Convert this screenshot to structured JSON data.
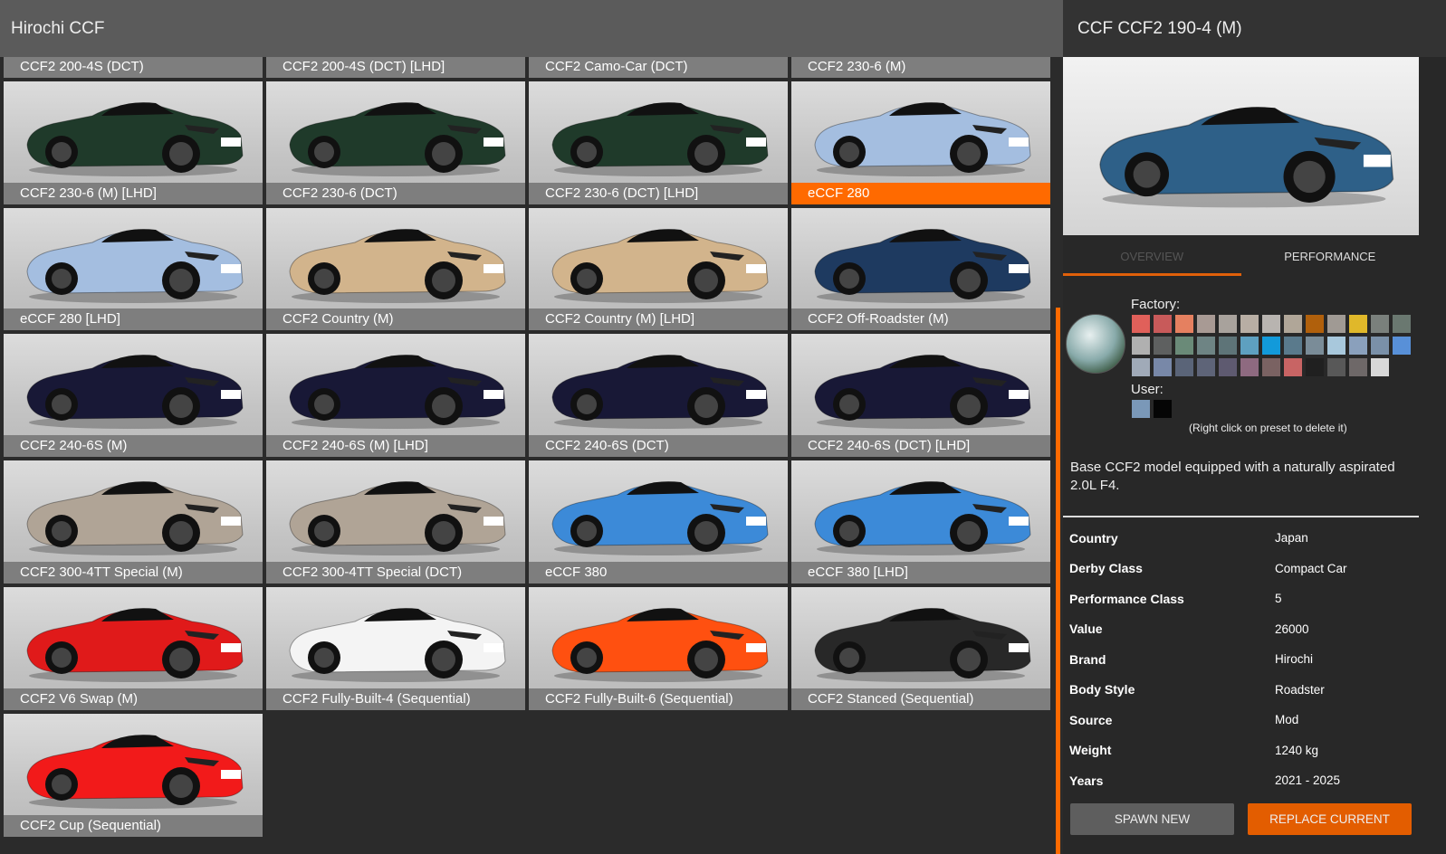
{
  "header": {
    "title": "Hirochi CCF"
  },
  "vehicles": [
    {
      "label": "CCF2 200-4S (DCT)",
      "color": "#2a3a2a"
    },
    {
      "label": "CCF2 200-4S (DCT) [LHD]",
      "color": "#2a3a2a"
    },
    {
      "label": "CCF2 Camo-Car (DCT)",
      "color": "#2a3a2a"
    },
    {
      "label": "CCF2 230-6 (M)",
      "color": "#2a3a2a"
    },
    {
      "label": "CCF2 230-6 (M) [LHD]",
      "color": "#1f3a2a"
    },
    {
      "label": "CCF2 230-6 (DCT)",
      "color": "#1f3a2a"
    },
    {
      "label": "CCF2 230-6 (DCT) [LHD]",
      "color": "#1f3a2a"
    },
    {
      "label": "eCCF 280",
      "color": "#a4bee0",
      "selected": true
    },
    {
      "label": "eCCF 280 [LHD]",
      "color": "#a4bee0"
    },
    {
      "label": "CCF2 Country (M)",
      "color": "#d2b48c"
    },
    {
      "label": "CCF2 Country (M) [LHD]",
      "color": "#d2b48c"
    },
    {
      "label": "CCF2 Off-Roadster (M)",
      "color": "#1e3a60"
    },
    {
      "label": "CCF2 240-6S (M)",
      "color": "#181836"
    },
    {
      "label": "CCF2 240-6S (M) [LHD]",
      "color": "#181836"
    },
    {
      "label": "CCF2 240-6S (DCT)",
      "color": "#181836"
    },
    {
      "label": "CCF2 240-6S (DCT) [LHD]",
      "color": "#181836"
    },
    {
      "label": "CCF2 300-4TT Special (M)",
      "color": "#b0a496"
    },
    {
      "label": "CCF2 300-4TT Special (DCT)",
      "color": "#b0a496"
    },
    {
      "label": "eCCF 380",
      "color": "#3c8ad8"
    },
    {
      "label": "eCCF 380 [LHD]",
      "color": "#3c8ad8"
    },
    {
      "label": "CCF2 V6 Swap (M)",
      "color": "#e01a1a"
    },
    {
      "label": "CCF2 Fully-Built-4 (Sequential)",
      "color": "#f4f4f4"
    },
    {
      "label": "CCF2 Fully-Built-6 (Sequential)",
      "color": "#ff5010"
    },
    {
      "label": "CCF2 Stanced (Sequential)",
      "color": "#282828"
    },
    {
      "label": "CCF2 Cup (Sequential)",
      "color": "#f21a1a"
    }
  ],
  "details": {
    "title": "CCF CCF2 190-4 (M)",
    "preview_color": "#2e6088",
    "tabs": [
      {
        "label": "OVERVIEW",
        "active": true
      },
      {
        "label": "PERFORMANCE"
      }
    ],
    "paint": {
      "factory_label": "Factory:",
      "user_label": "User:",
      "hint": "(Right click on preset to delete it)",
      "factory_colors": [
        [
          "#e0605a",
          "#c85a5a",
          "#e58060",
          "#a89a94",
          "#a8a29c",
          "#b8aea4",
          "#b8b4b0",
          "#b0a698",
          "#b0600c",
          "#a09a94",
          "#e0b82a",
          "#7a807c",
          "#6a7870"
        ],
        [
          "#b0b0b0",
          "#5e6060",
          "#6a8a78",
          "#6e8484",
          "#5e7478",
          "#5ea0c0",
          "#129ada",
          "#5a7a8c",
          "#7a8c98",
          "#a8c8dc",
          "#8aa0bc",
          "#7a90a8",
          "#5890d8"
        ],
        [
          "#a0aab8",
          "#7888a8",
          "#5a6478",
          "#5e6478",
          "#5e5a70",
          "#8e6a80",
          "#7a6262",
          "#c86464",
          "#202020",
          "#585858",
          "#6e6868",
          "#d8d8d8"
        ]
      ],
      "user_colors": [
        "#7a98b8",
        "#050505"
      ]
    },
    "description": "Base CCF2 model equipped with a naturally aspirated 2.0L F4.",
    "properties": [
      {
        "key": "Country",
        "value": "Japan"
      },
      {
        "key": "Derby Class",
        "value": "Compact Car"
      },
      {
        "key": "Performance Class",
        "value": "5"
      },
      {
        "key": "Value",
        "value": "26000"
      },
      {
        "key": "Brand",
        "value": "Hirochi"
      },
      {
        "key": "Body Style",
        "value": "Roadster"
      },
      {
        "key": "Source",
        "value": "Mod"
      },
      {
        "key": "Weight",
        "value": "1240 kg"
      },
      {
        "key": "Years",
        "value": "2021 - 2025"
      }
    ],
    "spawn_label": "SPAWN NEW",
    "replace_label": "REPLACE CURRENT"
  }
}
